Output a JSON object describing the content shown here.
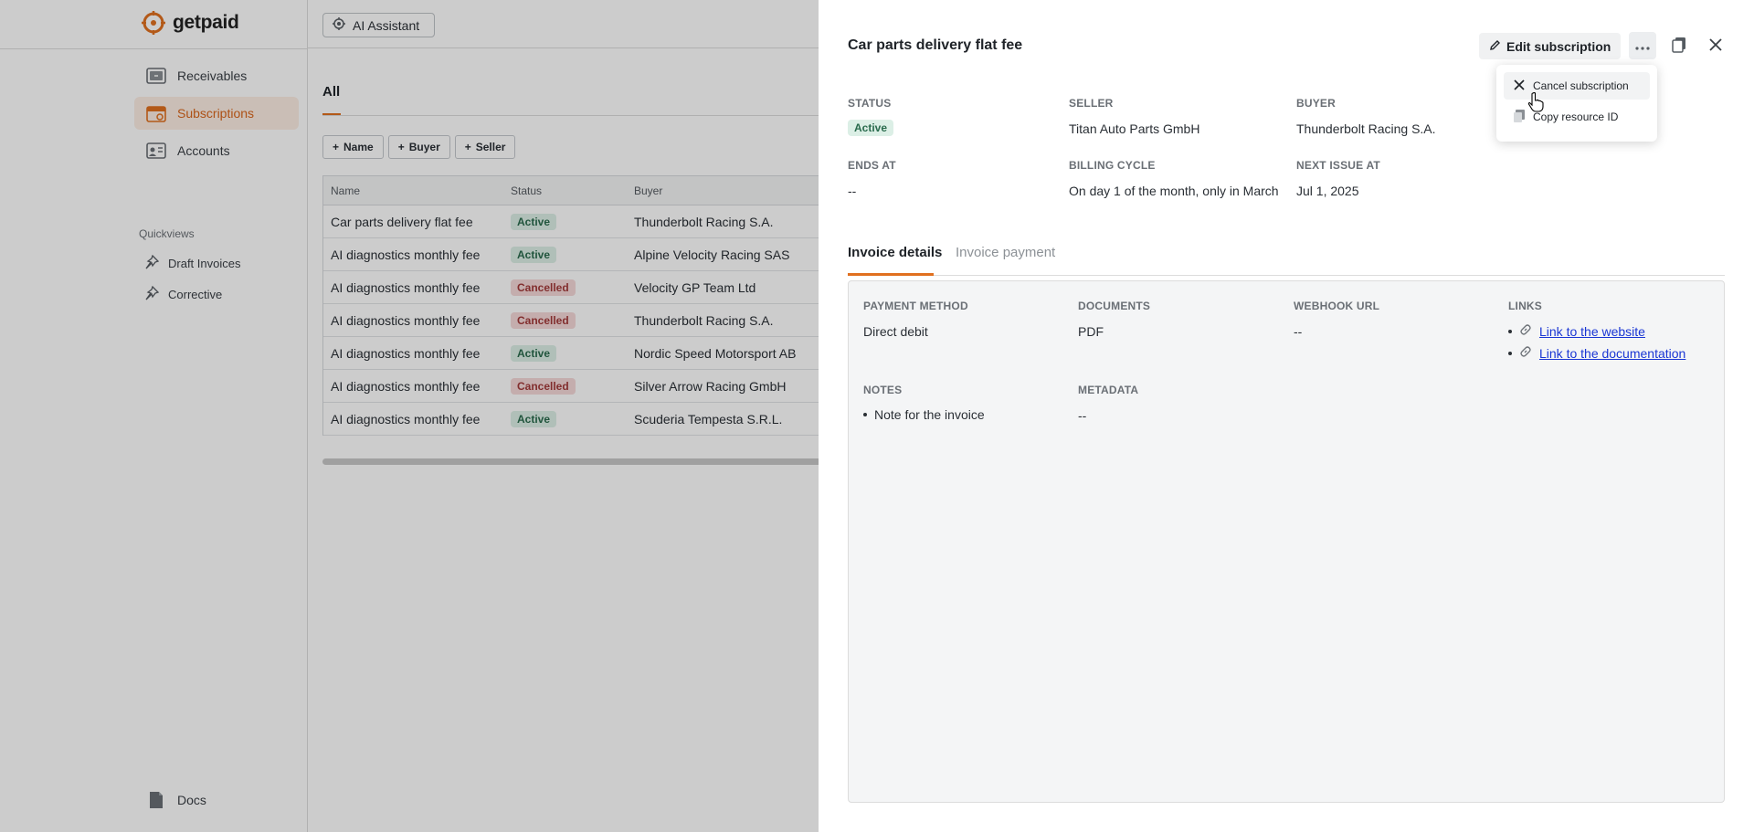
{
  "brand": {
    "name": "getpaid",
    "accent": "#e0701f"
  },
  "sidebar": {
    "items": [
      {
        "label": "Receivables",
        "icon": "receivables-icon",
        "active": false
      },
      {
        "label": "Subscriptions",
        "icon": "calendar-icon",
        "active": true
      },
      {
        "label": "Accounts",
        "icon": "accounts-icon",
        "active": false
      }
    ],
    "quickviews_label": "Quickviews",
    "quickviews": [
      {
        "label": "Draft Invoices",
        "icon": "pin-icon"
      },
      {
        "label": "Corrective",
        "icon": "pin-icon"
      }
    ],
    "docs_label": "Docs"
  },
  "topbar": {
    "ai_label": "AI Assistant"
  },
  "list": {
    "tab": "All",
    "filters": [
      "Name",
      "Buyer",
      "Seller"
    ],
    "columns": [
      "Name",
      "Status",
      "Buyer"
    ],
    "rows": [
      {
        "name": "Car parts delivery flat fee",
        "status": "Active",
        "buyer": "Thunderbolt Racing S.A."
      },
      {
        "name": "AI diagnostics monthly fee",
        "status": "Active",
        "buyer": "Alpine Velocity Racing SAS"
      },
      {
        "name": "AI diagnostics monthly fee",
        "status": "Cancelled",
        "buyer": "Velocity GP Team Ltd"
      },
      {
        "name": "AI diagnostics monthly fee",
        "status": "Cancelled",
        "buyer": "Thunderbolt Racing S.A."
      },
      {
        "name": "AI diagnostics monthly fee",
        "status": "Active",
        "buyer": "Nordic Speed Motorsport AB"
      },
      {
        "name": "AI diagnostics monthly fee",
        "status": "Cancelled",
        "buyer": "Silver Arrow Racing GmbH"
      },
      {
        "name": "AI diagnostics monthly fee",
        "status": "Active",
        "buyer": "Scuderia Tempesta S.R.L."
      }
    ]
  },
  "panel": {
    "title": "Car parts delivery flat fee",
    "edit_label": "Edit subscription",
    "fields": {
      "status_label": "Status",
      "status_value": "Active",
      "seller_label": "Seller",
      "seller_value": "Titan Auto Parts GmbH",
      "buyer_label": "Buyer",
      "buyer_value": "Thunderbolt Racing S.A.",
      "ends_label": "Ends at",
      "ends_value": "--",
      "billing_label": "Billing cycle",
      "billing_value": "On day 1 of the month, only in March",
      "next_label": "Next issue at",
      "next_value": "Jul 1, 2025"
    },
    "tabs": [
      "Invoice details",
      "Invoice payment"
    ],
    "details": {
      "payment_method_label": "Payment method",
      "payment_method_value": "Direct debit",
      "documents_label": "Documents",
      "documents_value": "PDF",
      "webhook_label": "Webhook URL",
      "webhook_value": "--",
      "links_label": "Links",
      "links": [
        "Link to the website",
        "Link to the documentation"
      ],
      "notes_label": "Notes",
      "notes": [
        "Note for the invoice"
      ],
      "metadata_label": "Metadata",
      "metadata_value": "--"
    }
  },
  "menu": {
    "items": [
      {
        "label": "Cancel subscription",
        "icon": "close-icon"
      },
      {
        "label": "Copy resource ID",
        "icon": "copy-icon"
      }
    ]
  }
}
